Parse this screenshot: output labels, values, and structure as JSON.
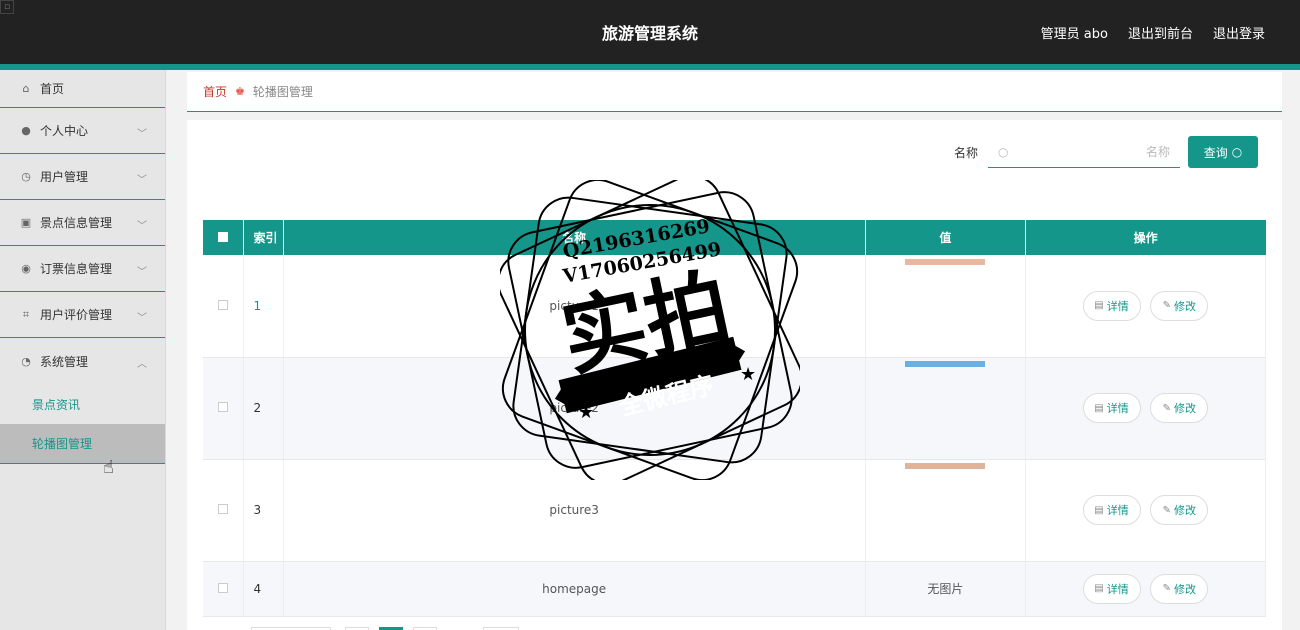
{
  "header": {
    "title": "旅游管理系统",
    "user": "管理员 abo",
    "to_front": "退出到前台",
    "logout": "退出登录"
  },
  "sidebar": {
    "items": [
      {
        "label": "首页",
        "icon": "home-icon"
      },
      {
        "label": "个人中心",
        "icon": "user-icon"
      },
      {
        "label": "用户管理",
        "icon": "clock-icon"
      },
      {
        "label": "景点信息管理",
        "icon": "clipboard-icon"
      },
      {
        "label": "订票信息管理",
        "icon": "bulb-icon"
      },
      {
        "label": "用户评价管理",
        "icon": "crop-icon"
      },
      {
        "label": "系统管理",
        "icon": "compass-icon"
      }
    ],
    "sub_items": [
      {
        "label": "景点资讯"
      },
      {
        "label": "轮播图管理"
      }
    ]
  },
  "breadcrumb": {
    "home": "首页",
    "current": "轮播图管理"
  },
  "search": {
    "label": "名称",
    "placeholder": "名称",
    "button": "查询"
  },
  "table": {
    "headers": [
      "索引",
      "名称",
      "值",
      "操作"
    ],
    "rows": [
      {
        "index": "1",
        "name": "picture1",
        "value": "",
        "thumb_color": "#e8b9a0"
      },
      {
        "index": "2",
        "name": "picture2",
        "value": "",
        "thumb_color": "#6ab0e0"
      },
      {
        "index": "3",
        "name": "picture3",
        "value": "",
        "thumb_color": "#e0b39a"
      },
      {
        "index": "4",
        "name": "homepage",
        "value": "无图片",
        "thumb_color": ""
      }
    ],
    "detail_label": "详情",
    "edit_label": "修改"
  },
  "stamp": {
    "contact1": "Q2196316269",
    "contact2": "V17060256499",
    "big": "实拍",
    "banner": "全微程序"
  },
  "colors": {
    "accent": "#14968a",
    "header_bg": "#222222"
  }
}
